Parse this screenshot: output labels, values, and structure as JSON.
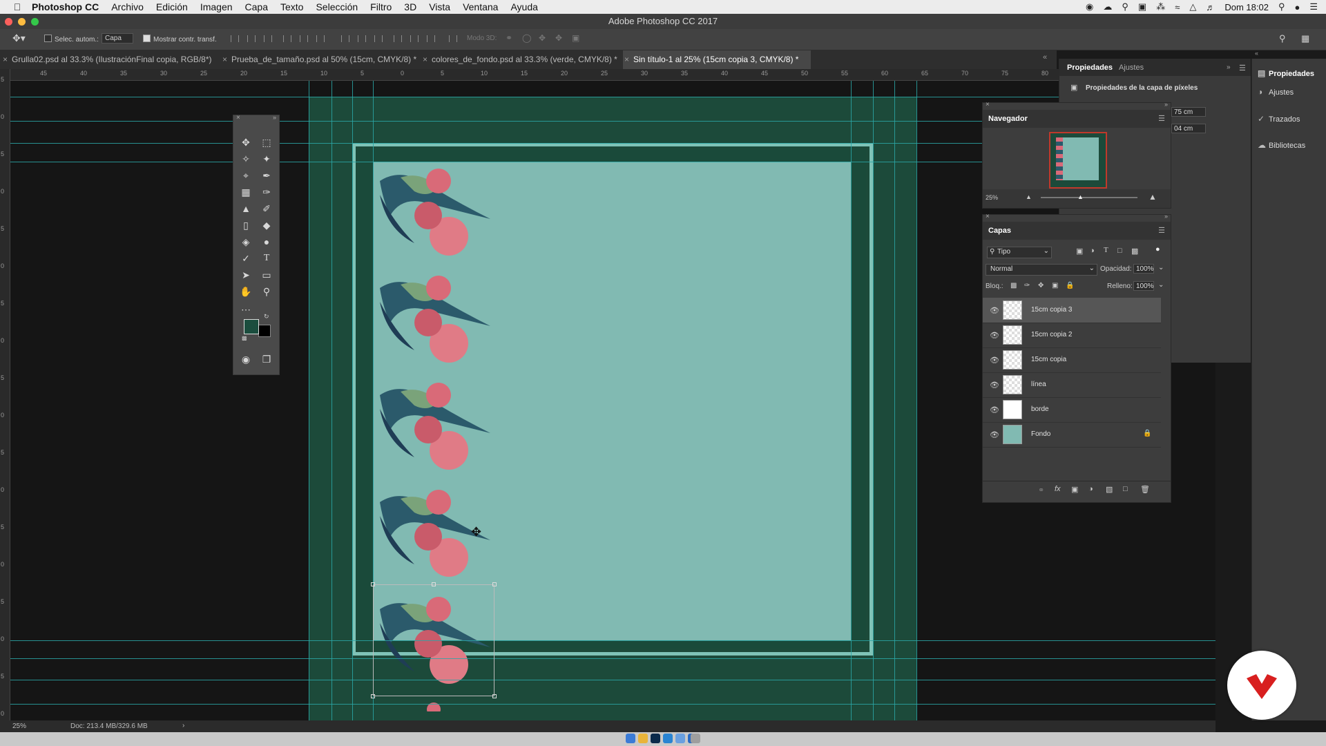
{
  "menubar": {
    "app_name": "Photoshop CC",
    "items": [
      "Archivo",
      "Edición",
      "Imagen",
      "Capa",
      "Texto",
      "Selección",
      "Filtro",
      "3D",
      "Vista",
      "Ventana",
      "Ayuda"
    ],
    "clock": "Dom 18:02"
  },
  "window": {
    "title": "Adobe Photoshop CC 2017"
  },
  "options": {
    "auto_select_label": "Selec. autom.:",
    "auto_select_target": "Capa",
    "show_transform_label": "Mostrar contr. transf.",
    "mode3d_label": "Modo 3D:"
  },
  "tabs": [
    {
      "label": "Grulla02.psd al 33.3% (IlustraciónFinal copia, RGB/8*)"
    },
    {
      "label": "Prueba_de_tamaño.psd al 50% (15cm, CMYK/8) *"
    },
    {
      "label": "colores_de_fondo.psd al 33.3% (verde, CMYK/8) *"
    },
    {
      "label": "Sin título-1 al 25% (15cm copia 3, CMYK/8) *"
    }
  ],
  "ruler": {
    "h_ticks": [
      "45",
      "40",
      "35",
      "30",
      "25",
      "20",
      "15",
      "10",
      "5",
      "0",
      "5",
      "10",
      "15",
      "20",
      "25",
      "30",
      "35",
      "40",
      "45",
      "50",
      "55",
      "60",
      "65",
      "70",
      "75",
      "80"
    ],
    "v_ticks": [
      "5",
      "0",
      "5",
      "0",
      "5",
      "0",
      "5",
      "0",
      "5",
      "0",
      "5",
      "0",
      "5",
      "0",
      "5",
      "0",
      "5",
      "0"
    ]
  },
  "status": {
    "zoom": "25%",
    "doc": "Doc: 213.4 MB/329.6 MB"
  },
  "properties": {
    "tab_active": "Propiedades",
    "tab_other": "Ajustes",
    "subtitle": "Propiedades de la capa de píxeles",
    "w_value": "75 cm",
    "h_value": "04 cm"
  },
  "navigator": {
    "title": "Navegador",
    "zoom": "25%"
  },
  "layers": {
    "title": "Capas",
    "filter_kind": "Tipo",
    "blend_mode": "Normal",
    "opacity_label": "Opacidad:",
    "opacity_value": "100%",
    "lock_label": "Bloq.:",
    "fill_label": "Relleno:",
    "fill_value": "100%",
    "items": [
      {
        "name": "15cm copia 3",
        "selected": true
      },
      {
        "name": "15cm copia 2",
        "selected": false
      },
      {
        "name": "15cm copia",
        "selected": false
      },
      {
        "name": "línea",
        "selected": false
      },
      {
        "name": "borde",
        "selected": false
      },
      {
        "name": "Fondo",
        "selected": false,
        "locked": true
      }
    ]
  },
  "rightdock": {
    "items": [
      "Propiedades",
      "Ajustes",
      "Trazados",
      "Bibliotecas"
    ]
  },
  "colors": {
    "foreground": "#1b4d3e",
    "background": "#000000",
    "canvas_teal": "#81bab2",
    "frame_dark": "#1c4a3a",
    "brand_red": "#d81f1f"
  }
}
